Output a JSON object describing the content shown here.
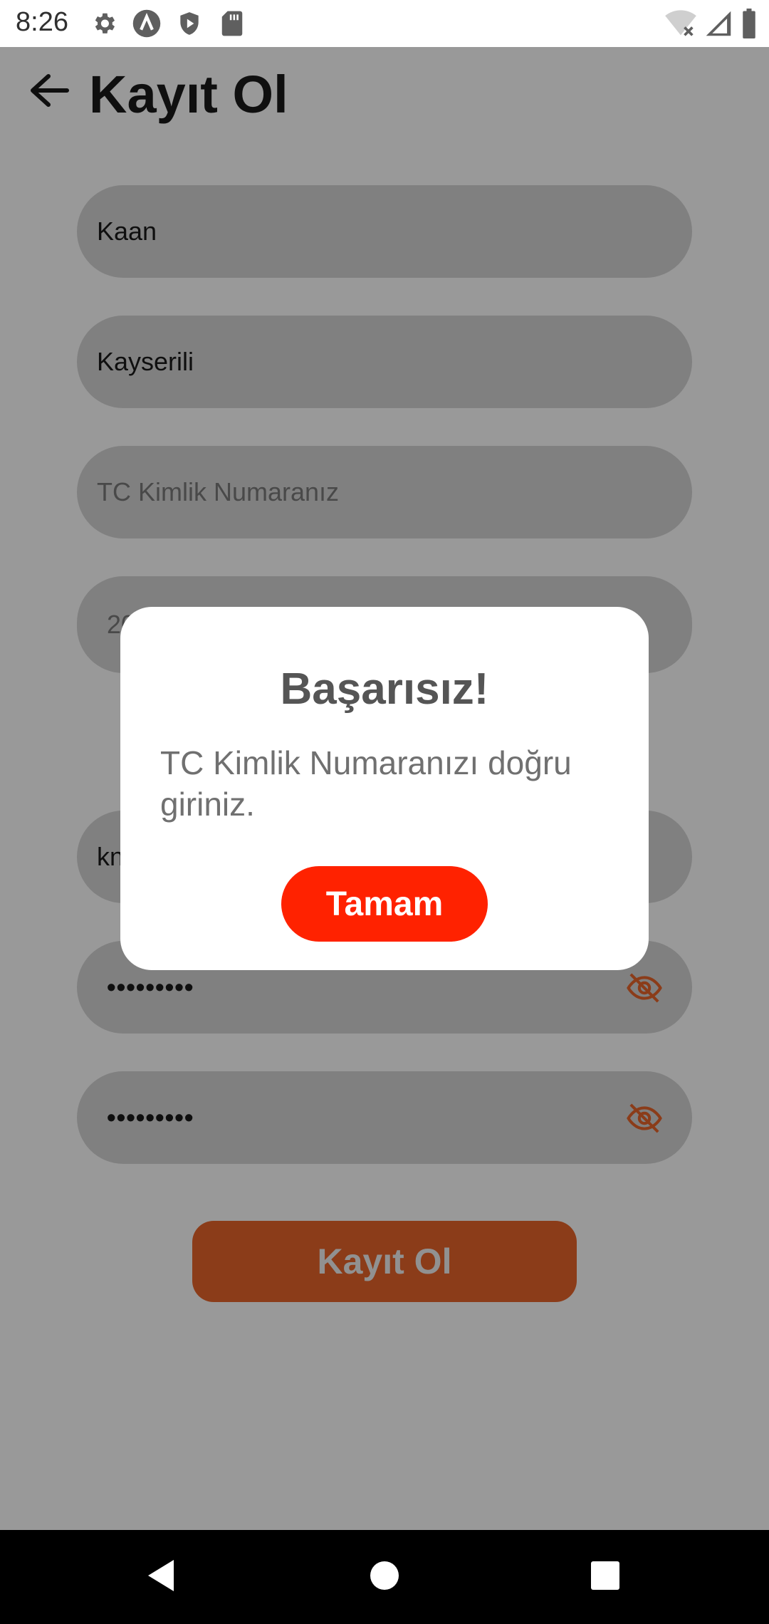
{
  "status_bar": {
    "time": "8:26",
    "left_icons": [
      "gear-icon",
      "a-circle-icon",
      "shield-play-icon",
      "sd-card-icon"
    ],
    "right_icons": [
      "wifi-off-icon",
      "signal-icon",
      "battery-icon"
    ]
  },
  "header": {
    "back_icon": "arrow-left-icon",
    "title": "Kayıt Ol"
  },
  "form": {
    "first_name_value": "Kaan",
    "last_name_value": "Kayserili",
    "tc_placeholder": "TC Kimlik Numaranız",
    "date_value_partial": "20",
    "email_value_partial": "kn",
    "password_value": "•••••••••",
    "password_confirm_value": "•••••••••",
    "eye_icon": "eye-off-icon",
    "submit_label": "Kayıt Ol"
  },
  "dialog": {
    "title": "Başarısız!",
    "message": "TC Kimlik Numaranızı doğru giriniz.",
    "ok_label": "Tamam"
  },
  "colors": {
    "accent_orange": "#e8642a",
    "dialog_button_red": "#ff2200",
    "field_bg": "#d6d6d6"
  },
  "nav_bar": {
    "icons": [
      "back-triangle-icon",
      "home-circle-icon",
      "recents-square-icon"
    ]
  }
}
